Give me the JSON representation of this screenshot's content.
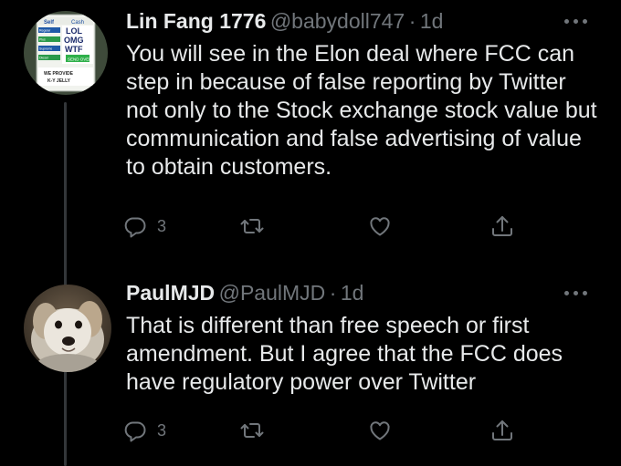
{
  "tweets": [
    {
      "author_name": "Lin Fang 1776",
      "handle": "@babydoll747",
      "separator": "·",
      "time": "1d",
      "text": "You will see in the Elon deal where FCC can step in because of false reporting by Twitter not only to the Stock exchange stock value but communication and false advertising of value to obtain customers.",
      "reply_count": "3",
      "avatar": {
        "type": "gas-station-price-sign",
        "sign_header": [
          "Self",
          "Cash"
        ],
        "sign_rows": [
          {
            "label": "Regular",
            "value": "LOL"
          },
          {
            "label": "Plus",
            "value": "OMG"
          },
          {
            "label": "Supreme",
            "value": "WTF"
          },
          {
            "label": "Diesel",
            "value": "SEND OVER"
          }
        ],
        "sign_footer": [
          "WE PROVIDE",
          "K-Y JELLY"
        ]
      }
    },
    {
      "author_name": "PaulMJD",
      "handle": "@PaulMJD",
      "separator": "·",
      "time": "1d",
      "text": "That is different than free speech or first amendment. But I agree that the FCC does have regulatory power over Twitter",
      "reply_count": "3",
      "avatar": {
        "type": "dog-photo"
      }
    }
  ],
  "icons": {
    "reply": "reply-icon",
    "retweet": "retweet-icon",
    "like": "heart-icon",
    "share": "share-icon",
    "more": "more-icon"
  },
  "colors": {
    "background": "#000000",
    "text_primary": "#e7e9ea",
    "text_secondary": "#71767b",
    "thread_line": "#333639"
  }
}
